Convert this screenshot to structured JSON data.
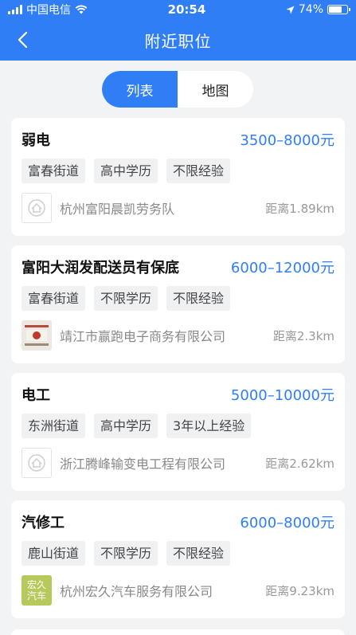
{
  "status_bar": {
    "carrier": "中国电信",
    "time": "20:54",
    "battery": "74%",
    "battery_level": 0.74
  },
  "nav": {
    "title": "附近职位"
  },
  "toggle": {
    "list": "列表",
    "map": "地图"
  },
  "jobs": [
    {
      "title": "弱电",
      "salary": "3500–8000元",
      "tags": [
        "富春街道",
        "高中学历",
        "不限经验"
      ],
      "company": "杭州富阳晨凯劳务队",
      "distance": "距离1.89km",
      "logo": "default-logo-icon"
    },
    {
      "title": "富阳大润发配送员有保底",
      "salary": "6000–12000元",
      "tags": [
        "富春街道",
        "不限学历",
        "不限经验"
      ],
      "company": "靖江市赢跑电子商务有限公司",
      "distance": "距离2.3km",
      "logo": "company-photo-logo"
    },
    {
      "title": "电工",
      "salary": "5000–10000元",
      "tags": [
        "东洲街道",
        "高中学历",
        "3年以上经验"
      ],
      "company": "浙江腾峰输变电工程有限公司",
      "distance": "距离2.62km",
      "logo": "default-logo-icon"
    },
    {
      "title": "汽修工",
      "salary": "6000–8000元",
      "tags": [
        "鹿山街道",
        "不限学历",
        "不限经验"
      ],
      "company": "杭州宏久汽车服务有限公司",
      "distance": "距离9.23km",
      "logo": "text-logo",
      "logo_text": [
        "宏久",
        "汽车"
      ]
    }
  ],
  "colors": {
    "primary": "#2f7ef6",
    "background": "#f2f3f5"
  }
}
